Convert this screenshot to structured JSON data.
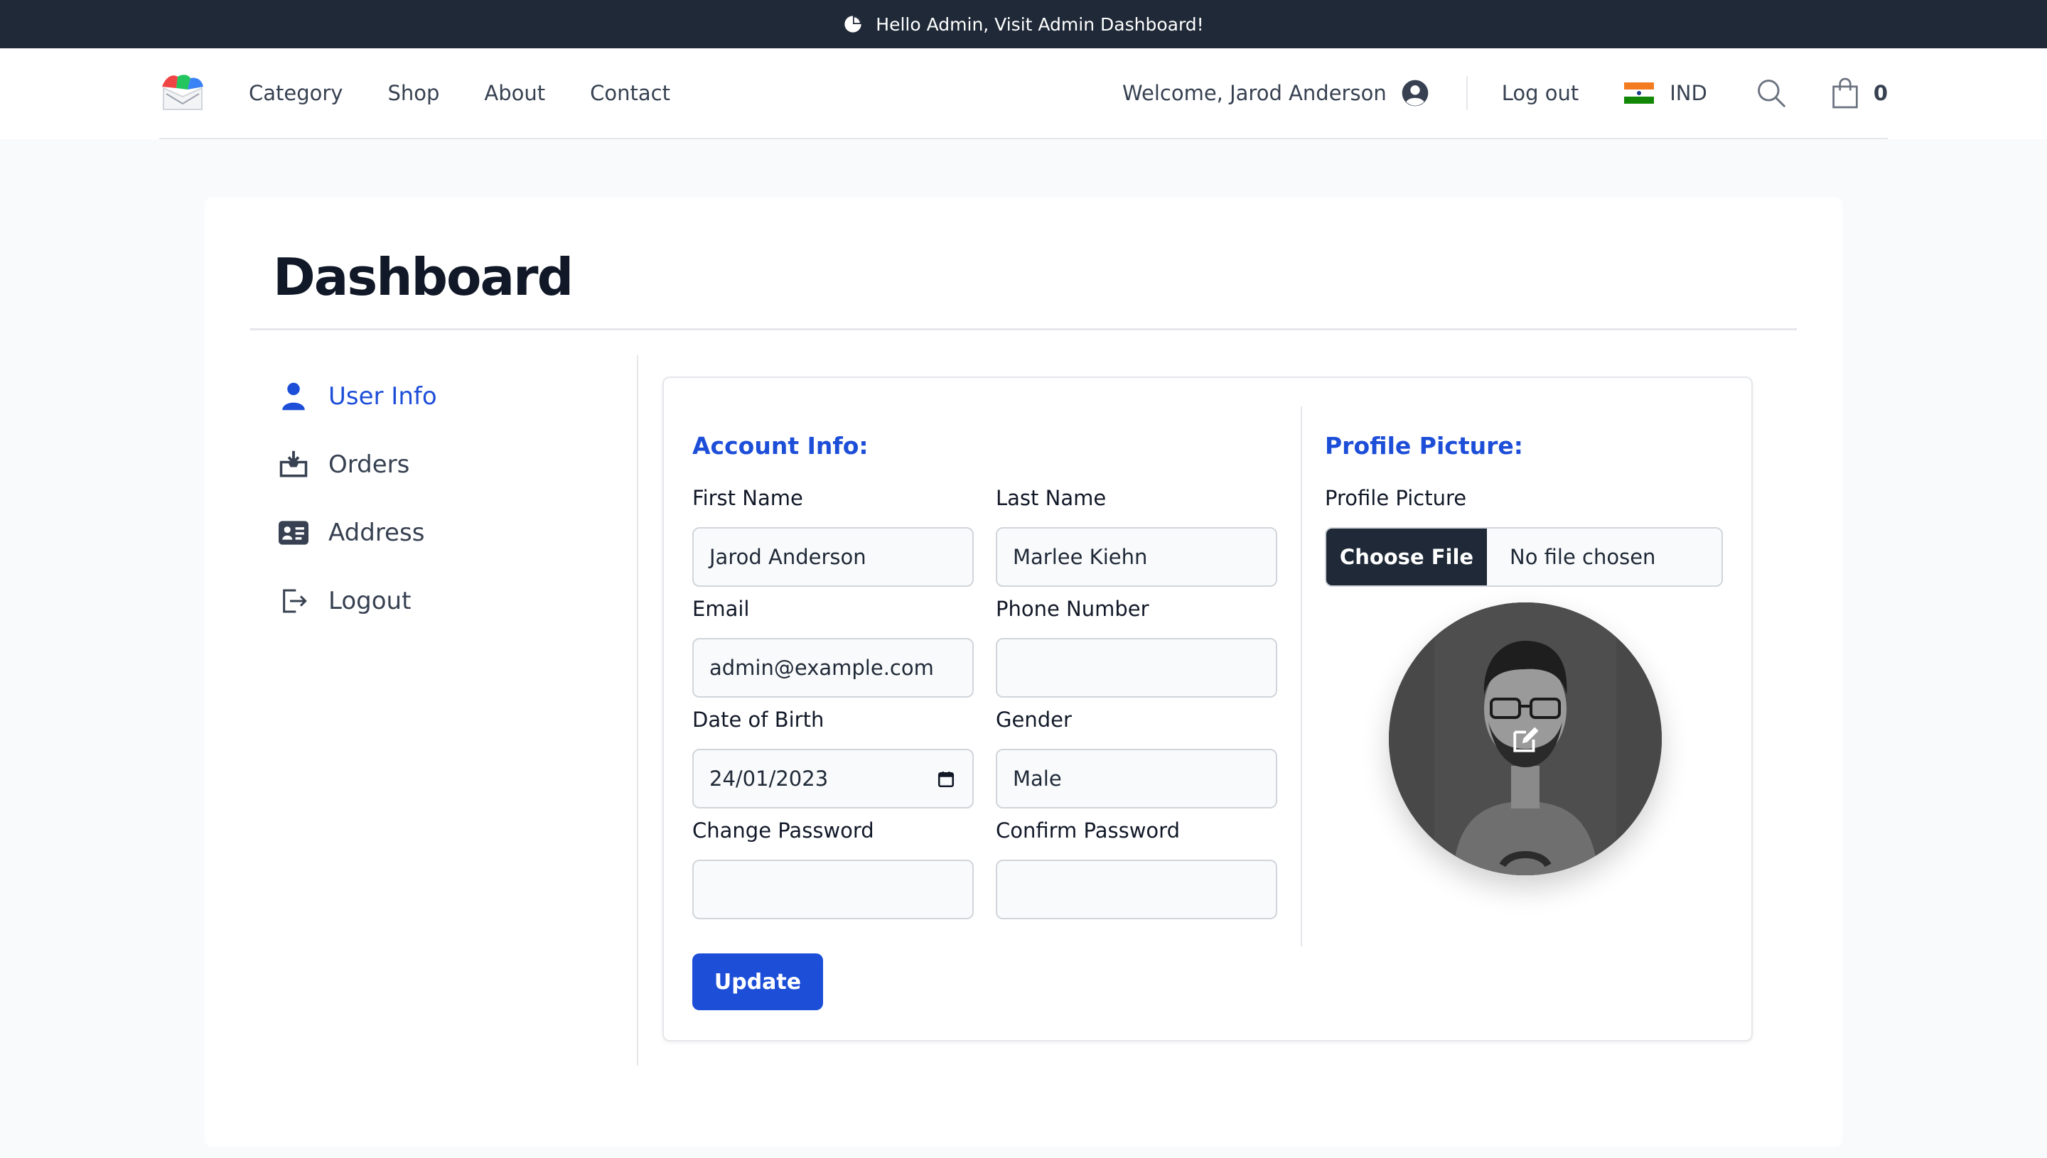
{
  "topbar": {
    "message": "Hello Admin, Visit Admin Dashboard!",
    "icon": "pie-chart-icon"
  },
  "nav": {
    "links": [
      "Category",
      "Shop",
      "About",
      "Contact"
    ],
    "welcome": "Welcome, Jarod Anderson",
    "logout": "Log out",
    "country": "IND",
    "cart_count": "0"
  },
  "page": {
    "title": "Dashboard"
  },
  "sidebar": {
    "items": [
      {
        "label": "User Info",
        "icon": "user-icon",
        "active": true
      },
      {
        "label": "Orders",
        "icon": "inbox-download-icon"
      },
      {
        "label": "Address",
        "icon": "address-card-icon"
      },
      {
        "label": "Logout",
        "icon": "logout-icon"
      }
    ]
  },
  "account": {
    "title": "Account Info:",
    "first_name_label": "First Name",
    "first_name": "Jarod Anderson",
    "last_name_label": "Last Name",
    "last_name": "Marlee Kiehn",
    "email_label": "Email",
    "email": "admin@example.com",
    "phone_label": "Phone Number",
    "phone": "",
    "dob_label": "Date of Birth",
    "dob": "24/01/2023",
    "gender_label": "Gender",
    "gender": "Male",
    "change_password_label": "Change Password",
    "confirm_password_label": "Confirm Password",
    "update_label": "Update"
  },
  "profile": {
    "title": "Profile Picture:",
    "label": "Profile Picture",
    "choose_file": "Choose File",
    "no_file": "No file chosen"
  },
  "colors": {
    "accent": "#1d4ed8",
    "dark": "#1f2937",
    "flag_saffron": "#f47c20",
    "flag_green": "#138808"
  }
}
